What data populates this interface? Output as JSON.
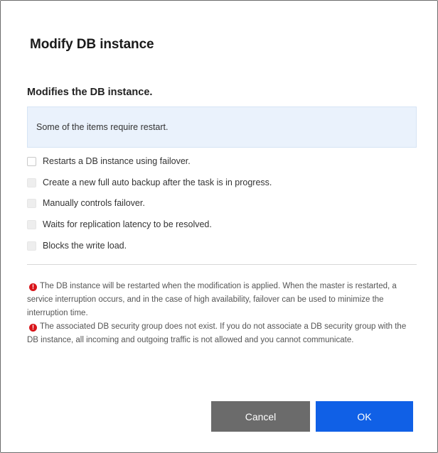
{
  "dialog": {
    "title": "Modify DB instance",
    "subtitle": "Modifies the DB instance.",
    "info": "Some of the items require restart.",
    "options": [
      {
        "label": "Restarts a DB instance using failover.",
        "disabled": false,
        "checked": false
      },
      {
        "label": "Create a new full auto backup after the task is in progress.",
        "disabled": true,
        "checked": false
      },
      {
        "label": "Manually controls failover.",
        "disabled": true,
        "checked": false
      },
      {
        "label": "Waits for replication latency to be resolved.",
        "disabled": true,
        "checked": false
      },
      {
        "label": "Blocks the write load.",
        "disabled": true,
        "checked": false
      }
    ],
    "notes": [
      {
        "icon": "warning-icon",
        "text": "The DB instance will be restarted when the modification is applied. When the master is restarted, a service interruption occurs, and in the case of high availability, failover can be used to minimize the interruption time."
      },
      {
        "icon": "warning-icon",
        "text": "The associated DB security group does not exist. If you do not associate a DB security group with the DB instance, all incoming and outgoing traffic is not allowed and you cannot communicate."
      }
    ],
    "buttons": {
      "cancel": "Cancel",
      "ok": "OK"
    }
  },
  "colors": {
    "primary": "#1060e6",
    "secondary": "#6b6b6b",
    "warning": "#d9161b",
    "info_background": "#eaf2fc"
  }
}
